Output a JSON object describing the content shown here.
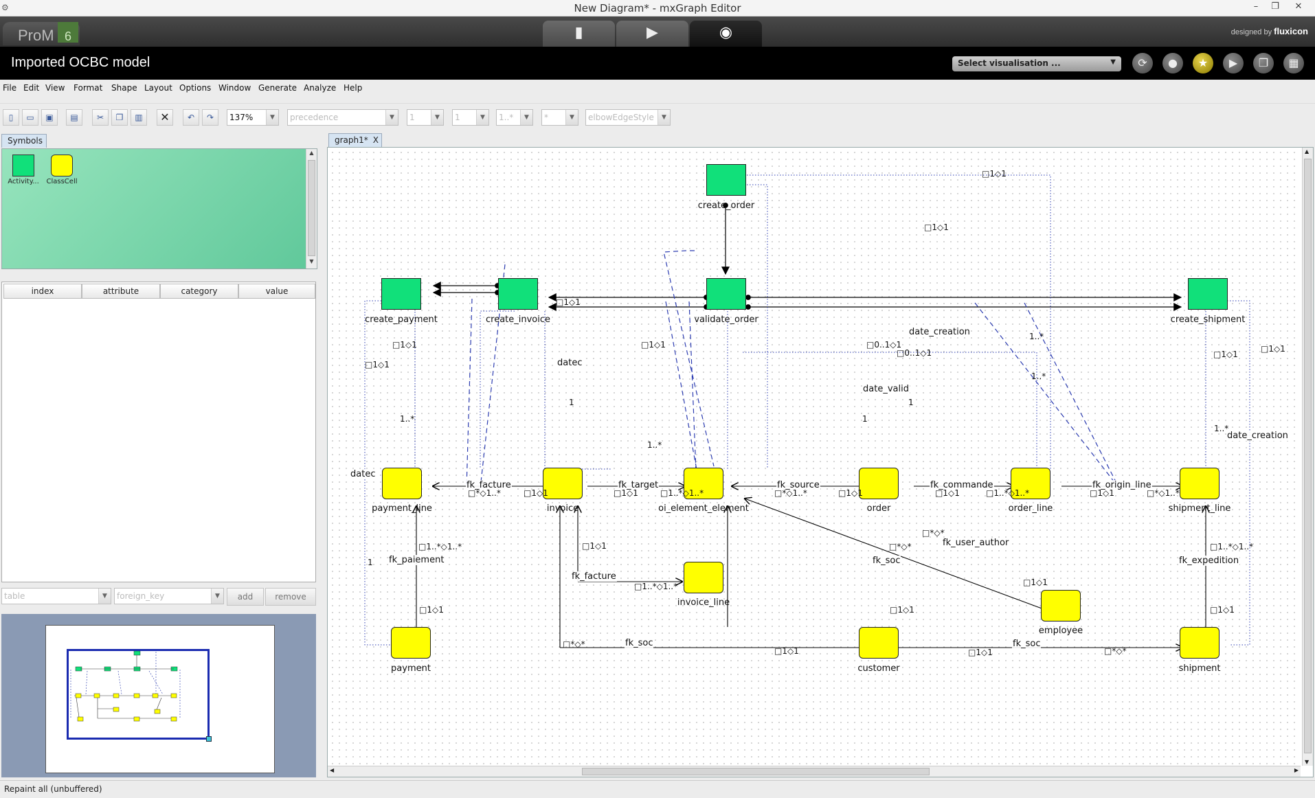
{
  "window": {
    "title": "New Diagram* - mxGraph Editor",
    "minimize": "–",
    "maximize": "❐",
    "close": "✕"
  },
  "prom": {
    "logo_text": "ProM",
    "logo_version": "6",
    "tabs": [
      {
        "name": "workspace",
        "glyph": "▮"
      },
      {
        "name": "actions",
        "glyph": "▶"
      },
      {
        "name": "views",
        "glyph": "◉"
      }
    ],
    "brand_prefix": "designed by",
    "brand_name": "fluxicon",
    "model_title": "Imported OCBC model",
    "visualisation_select": "Select visualisation ...",
    "round_buttons": [
      {
        "name": "refresh-icon",
        "glyph": "⟳"
      },
      {
        "name": "drop-icon",
        "glyph": "●"
      },
      {
        "name": "star-icon",
        "glyph": "★"
      },
      {
        "name": "play-icon",
        "glyph": "▶"
      },
      {
        "name": "copy-icon",
        "glyph": "❐"
      },
      {
        "name": "grid-icon",
        "glyph": "▦"
      }
    ]
  },
  "menu": [
    "File",
    "Edit",
    "View",
    "Format",
    "Shape",
    "Layout",
    "Options",
    "Window",
    "Generate",
    "Analyze",
    "Help"
  ],
  "toolbar": {
    "zoom": "137%",
    "edge_type": "precedence",
    "combo_a": "1",
    "combo_b": "1",
    "combo_c": "1..*",
    "combo_d": "*",
    "edge_style": "elbowEdgeStyle"
  },
  "symbols": {
    "tab_label": "Symbols",
    "items": [
      {
        "label": "Activity...",
        "color": "#11e07a"
      },
      {
        "label": "ClassCell",
        "color": "#ffff00"
      }
    ]
  },
  "attributes": {
    "columns": [
      "index",
      "attribute",
      "category",
      "value"
    ],
    "table_placeholder": "table",
    "foreign_key_placeholder": "foreign_key",
    "add_label": "add",
    "remove_label": "remove"
  },
  "graph": {
    "tab_label": "graph1*",
    "close_label": "X",
    "activities": [
      {
        "id": "create_order",
        "label": "create_order"
      },
      {
        "id": "create_payment",
        "label": "create_payment"
      },
      {
        "id": "create_invoice",
        "label": "create_invoice"
      },
      {
        "id": "validate_order",
        "label": "validate_order"
      },
      {
        "id": "create_shipment",
        "label": "create_shipment"
      }
    ],
    "classes": [
      {
        "id": "payment_line",
        "label": "payment_line"
      },
      {
        "id": "invoice",
        "label": "invoice"
      },
      {
        "id": "oi_element_element",
        "label": "oi_element_element"
      },
      {
        "id": "order",
        "label": "order"
      },
      {
        "id": "order_line",
        "label": "order_line"
      },
      {
        "id": "shipment_line",
        "label": "shipment_line"
      },
      {
        "id": "invoice_line",
        "label": "invoice_line"
      },
      {
        "id": "employee",
        "label": "employee"
      },
      {
        "id": "payment",
        "label": "payment"
      },
      {
        "id": "customer",
        "label": "customer"
      },
      {
        "id": "shipment",
        "label": "shipment"
      }
    ],
    "edge_labels": {
      "fk_facture_top": "fk_facture",
      "fk_target": "fk_target",
      "fk_source": "fk_source",
      "fk_commande": "fk_commande",
      "fk_origin_line": "fk_origin_line",
      "fk_paiement": "fk_paiement",
      "fk_facture_bottom": "fk_facture",
      "fk_soc_left": "fk_soc",
      "fk_soc_mid": "fk_soc",
      "fk_soc_right": "fk_soc",
      "fk_user_author": "fk_user_author",
      "fk_expedition": "fk_expedition",
      "datec_left": "datec",
      "datec_mid": "datec",
      "date_valid": "date_valid",
      "date_creation_top": "date_creation",
      "date_creation_right": "date_creation"
    },
    "cardinalities": {
      "c_top1": "□1◇1",
      "c_top2": "□1◇1",
      "c_inv": "□1◇1",
      "c_pay1": "□1◇1",
      "c_pay2": "□1◇1",
      "c_inv2": "□1◇1",
      "c_val1": "□0..1◇1",
      "c_val2": "□0..1◇1",
      "c_ship1": "□1◇1",
      "c_ship2": "□1◇1",
      "c_1star_a": "1..*",
      "c_1star_b": "1..*",
      "c_1star_c": "1..*",
      "c_1star_d": "1..*",
      "c_1star_e": "1..*",
      "c_one_a": "1",
      "c_one_b": "1",
      "c_one_c": "1",
      "c_one_d": "1",
      "c_pl": "□*◇1..*",
      "c_inv_l": "□1◇1",
      "c_tgt": "□1◇1",
      "c_oi": "□1..*◇1..*",
      "c_src": "□*◇1..*",
      "c_ord": "□1◇1",
      "c_cmd": "□1◇1",
      "c_ol": "□1..*◇1..*",
      "c_orig": "□1◇1",
      "c_sl": "□*◇1..*",
      "c_pai": "□1..*◇1..*",
      "c_pai2": "□1◇1",
      "c_fac2": "□1◇1",
      "c_il": "□1..*◇1..*",
      "c_soc_l1": "□*◇*",
      "c_soc_l2": "□1◇1",
      "c_soc_m": "□*◇*",
      "c_soc_m2": "□1◇1",
      "c_ua": "□*◇*",
      "c_emp": "□1◇1",
      "c_exp": "□1..*◇1..*",
      "c_exp2": "□1◇1",
      "c_soc_r1": "□1◇1",
      "c_soc_r2": "□*◇*"
    }
  },
  "status": "Repaint all (unbuffered)"
}
